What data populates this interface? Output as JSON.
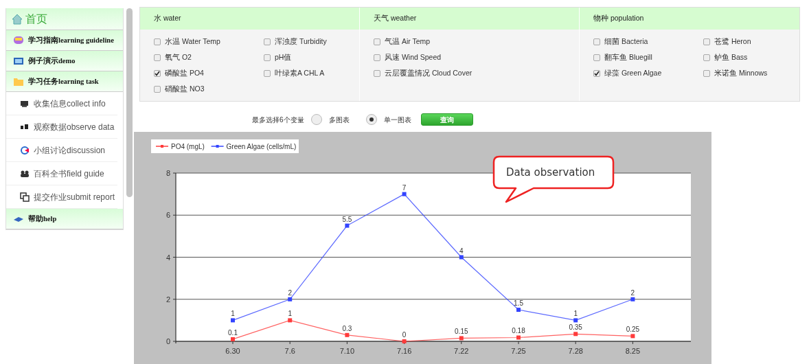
{
  "sidebar": {
    "home": {
      "label": "首页"
    },
    "items": [
      {
        "kind": "header",
        "label": "学习指南learning guideline"
      },
      {
        "kind": "header",
        "label": "例子演示demo"
      },
      {
        "kind": "header",
        "label": "学习任务learning task"
      },
      {
        "kind": "sub",
        "label": "收集信息collect info"
      },
      {
        "kind": "sub",
        "label": "观察数据observe data"
      },
      {
        "kind": "sub",
        "label": "小组讨论discussion"
      },
      {
        "kind": "sub",
        "label": "百科全书field guide"
      },
      {
        "kind": "sub",
        "label": "提交作业submit report"
      },
      {
        "kind": "header",
        "label": "帮助help"
      }
    ]
  },
  "variables": [
    {
      "title": "水 water",
      "items": [
        {
          "label": "水温 Water Temp",
          "checked": false
        },
        {
          "label": "浑浊度 Turbidity",
          "checked": false
        },
        {
          "label": "氧气 O2",
          "checked": false
        },
        {
          "label": "pH值",
          "checked": false
        },
        {
          "label": "磷酸盐 PO4",
          "checked": true
        },
        {
          "label": "叶绿素A CHL A",
          "checked": false
        },
        {
          "label": "硝酸盐 NO3",
          "checked": false
        }
      ]
    },
    {
      "title": "天气 weather",
      "items": [
        {
          "label": "气温 Air Temp",
          "checked": false
        },
        {
          "label": "风速 Wind Speed",
          "checked": false
        },
        {
          "label": "云层覆盖情况 Cloud Cover",
          "checked": false
        }
      ]
    },
    {
      "title": "物种 population",
      "items": [
        {
          "label": "细菌 Bacteria",
          "checked": false
        },
        {
          "label": "苍鹭 Heron",
          "checked": false
        },
        {
          "label": "翻车鱼 Bluegill",
          "checked": false
        },
        {
          "label": "鲈鱼 Bass",
          "checked": false
        },
        {
          "label": "绿藻 Green Algae",
          "checked": true
        },
        {
          "label": "米诺鱼 Minnows",
          "checked": false
        }
      ]
    }
  ],
  "options": {
    "hint": "最多选择6个变量",
    "radios": [
      {
        "label": "多图表",
        "selected": false
      },
      {
        "label": "单一图表",
        "selected": true
      }
    ],
    "button": "查询"
  },
  "chart": {
    "chart_data": {
      "type": "line",
      "categories": [
        "6.30",
        "7.6",
        "7.10",
        "7.16",
        "7.22",
        "7.25",
        "7.28",
        "8.25"
      ],
      "series": [
        {
          "name": "PO4 (mgL)",
          "color": "#ff3b3b",
          "marker": "square",
          "values": [
            0.1,
            1,
            0.3,
            0,
            0.15,
            0.18,
            0.35,
            0.25
          ]
        },
        {
          "name": "Green Algae (cells/mL)",
          "color": "#3344ff",
          "marker": "square",
          "values": [
            1,
            2,
            5.5,
            7,
            4,
            1.5,
            1,
            2
          ]
        }
      ],
      "ylim": [
        0,
        8
      ],
      "grid": true,
      "legend": true,
      "yticks": [
        0,
        2,
        4,
        6,
        8
      ],
      "data_labels": true,
      "annotations": [
        {
          "text": "Data observation"
        }
      ]
    }
  }
}
